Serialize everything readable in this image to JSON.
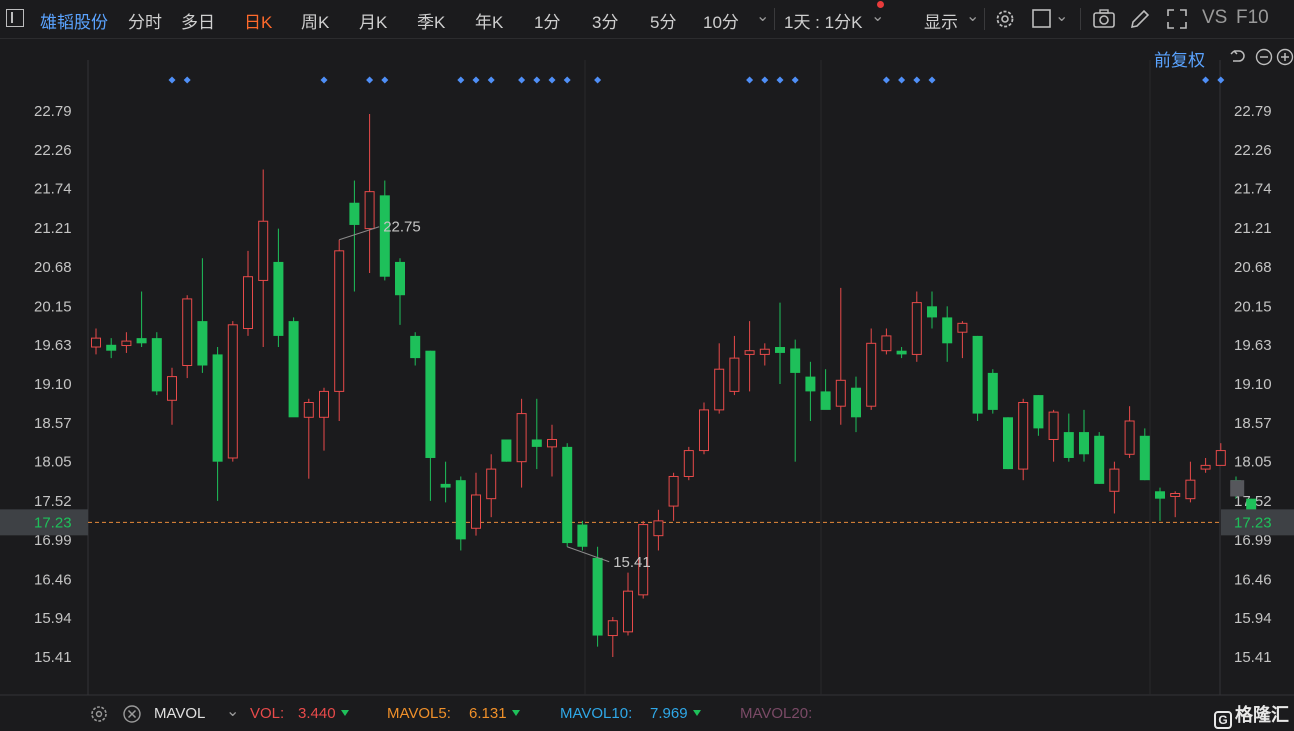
{
  "toolbar": {
    "stock_name": "雄韬股份",
    "periods": [
      "分时",
      "多日",
      "日K",
      "周K",
      "月K",
      "季K",
      "年K",
      "1分",
      "3分",
      "5分",
      "10分"
    ],
    "active_period": "日K",
    "range_label": "1天 : 1分K",
    "display_label": "显示",
    "vs_label": "VS",
    "f10_label": "F10"
  },
  "adjust_label": "前复权",
  "colors": {
    "up": "#e84a4a",
    "down": "#1ec05a",
    "marker": "#4f8ff7",
    "price_line": "#e88b3a"
  },
  "chart_data": {
    "type": "candlestick",
    "ylim": [
      15.1,
      23.1
    ],
    "yticks": [
      "22.79",
      "22.26",
      "21.74",
      "21.21",
      "20.68",
      "20.15",
      "19.63",
      "19.10",
      "18.57",
      "18.05",
      "17.52",
      "16.99",
      "16.46",
      "15.94",
      "15.41"
    ],
    "current_price": "17.23",
    "high_label": "22.75",
    "low_label": "15.41",
    "high_index": 16,
    "low_index": 31,
    "marker_indices": [
      5,
      6,
      15,
      18,
      19,
      24,
      25,
      26,
      28,
      29,
      30,
      31,
      33,
      43,
      44,
      45,
      46,
      52,
      53,
      54,
      55,
      73,
      74
    ],
    "candles": [
      {
        "o": 19.6,
        "h": 19.85,
        "l": 19.5,
        "c": 19.72
      },
      {
        "o": 19.63,
        "h": 19.72,
        "l": 19.45,
        "c": 19.55
      },
      {
        "o": 19.62,
        "h": 19.8,
        "l": 19.52,
        "c": 19.68
      },
      {
        "o": 19.72,
        "h": 20.35,
        "l": 19.6,
        "c": 19.65
      },
      {
        "o": 19.72,
        "h": 19.8,
        "l": 18.95,
        "c": 19.0
      },
      {
        "o": 18.88,
        "h": 19.32,
        "l": 18.55,
        "c": 19.2
      },
      {
        "o": 19.35,
        "h": 20.3,
        "l": 19.18,
        "c": 20.25
      },
      {
        "o": 19.95,
        "h": 20.8,
        "l": 19.25,
        "c": 19.35
      },
      {
        "o": 19.5,
        "h": 19.6,
        "l": 17.52,
        "c": 18.05
      },
      {
        "o": 18.1,
        "h": 19.95,
        "l": 18.05,
        "c": 19.9
      },
      {
        "o": 19.85,
        "h": 20.9,
        "l": 19.75,
        "c": 20.55
      },
      {
        "o": 20.5,
        "h": 22.0,
        "l": 19.6,
        "c": 21.3
      },
      {
        "o": 20.75,
        "h": 21.2,
        "l": 19.6,
        "c": 19.75
      },
      {
        "o": 19.95,
        "h": 20.0,
        "l": 18.7,
        "c": 18.65
      },
      {
        "o": 18.65,
        "h": 18.9,
        "l": 17.82,
        "c": 18.85
      },
      {
        "o": 18.65,
        "h": 19.05,
        "l": 18.2,
        "c": 19.0
      },
      {
        "o": 19.0,
        "h": 21.05,
        "l": 18.6,
        "c": 20.9
      },
      {
        "o": 21.55,
        "h": 21.85,
        "l": 20.35,
        "c": 21.25
      },
      {
        "o": 21.2,
        "h": 22.75,
        "l": 20.6,
        "c": 21.7
      },
      {
        "o": 21.65,
        "h": 21.85,
        "l": 20.5,
        "c": 20.55
      },
      {
        "o": 20.75,
        "h": 20.8,
        "l": 19.9,
        "c": 20.3
      },
      {
        "o": 19.75,
        "h": 19.8,
        "l": 19.35,
        "c": 19.45
      },
      {
        "o": 19.55,
        "h": 19.55,
        "l": 17.52,
        "c": 18.1
      },
      {
        "o": 17.75,
        "h": 18.05,
        "l": 17.5,
        "c": 17.7
      },
      {
        "o": 17.8,
        "h": 17.85,
        "l": 16.85,
        "c": 17.0
      },
      {
        "o": 17.15,
        "h": 17.9,
        "l": 17.05,
        "c": 17.6
      },
      {
        "o": 17.55,
        "h": 18.15,
        "l": 17.3,
        "c": 17.95
      },
      {
        "o": 18.35,
        "h": 18.3,
        "l": 18.05,
        "c": 18.05
      },
      {
        "o": 18.05,
        "h": 18.9,
        "l": 17.7,
        "c": 18.7
      },
      {
        "o": 18.35,
        "h": 18.9,
        "l": 17.95,
        "c": 18.25
      },
      {
        "o": 18.25,
        "h": 18.55,
        "l": 17.85,
        "c": 18.35
      },
      {
        "o": 18.25,
        "h": 18.3,
        "l": 16.9,
        "c": 16.95
      },
      {
        "o": 17.2,
        "h": 17.25,
        "l": 16.85,
        "c": 16.9
      },
      {
        "o": 16.75,
        "h": 16.9,
        "l": 15.55,
        "c": 15.7
      },
      {
        "o": 15.7,
        "h": 15.95,
        "l": 15.41,
        "c": 15.9
      },
      {
        "o": 15.75,
        "h": 16.55,
        "l": 15.7,
        "c": 16.3
      },
      {
        "o": 16.25,
        "h": 17.25,
        "l": 16.2,
        "c": 17.2
      },
      {
        "o": 17.05,
        "h": 17.4,
        "l": 16.85,
        "c": 17.25
      },
      {
        "o": 17.45,
        "h": 17.9,
        "l": 17.25,
        "c": 17.85
      },
      {
        "o": 17.85,
        "h": 18.25,
        "l": 17.8,
        "c": 18.2
      },
      {
        "o": 18.2,
        "h": 18.85,
        "l": 18.15,
        "c": 18.75
      },
      {
        "o": 18.75,
        "h": 19.65,
        "l": 18.7,
        "c": 19.3
      },
      {
        "o": 19.0,
        "h": 19.75,
        "l": 18.95,
        "c": 19.45
      },
      {
        "o": 19.5,
        "h": 19.95,
        "l": 19.0,
        "c": 19.55
      },
      {
        "o": 19.5,
        "h": 19.65,
        "l": 19.35,
        "c": 19.57
      },
      {
        "o": 19.6,
        "h": 20.2,
        "l": 19.1,
        "c": 19.52
      },
      {
        "o": 19.58,
        "h": 19.7,
        "l": 18.05,
        "c": 19.25
      },
      {
        "o": 19.2,
        "h": 19.4,
        "l": 18.6,
        "c": 19.0
      },
      {
        "o": 19.0,
        "h": 19.3,
        "l": 18.8,
        "c": 18.75
      },
      {
        "o": 18.8,
        "h": 20.4,
        "l": 18.55,
        "c": 19.15
      },
      {
        "o": 19.05,
        "h": 19.2,
        "l": 18.45,
        "c": 18.65
      },
      {
        "o": 18.8,
        "h": 19.85,
        "l": 18.75,
        "c": 19.65
      },
      {
        "o": 19.55,
        "h": 19.85,
        "l": 19.5,
        "c": 19.75
      },
      {
        "o": 19.55,
        "h": 19.6,
        "l": 19.45,
        "c": 19.5
      },
      {
        "o": 19.5,
        "h": 20.35,
        "l": 19.4,
        "c": 20.2
      },
      {
        "o": 20.15,
        "h": 20.35,
        "l": 19.85,
        "c": 20.0
      },
      {
        "o": 20.0,
        "h": 20.15,
        "l": 19.4,
        "c": 19.65
      },
      {
        "o": 19.8,
        "h": 19.95,
        "l": 19.45,
        "c": 19.92
      },
      {
        "o": 19.75,
        "h": 19.75,
        "l": 18.6,
        "c": 18.7
      },
      {
        "o": 19.25,
        "h": 19.3,
        "l": 18.7,
        "c": 18.75
      },
      {
        "o": 18.65,
        "h": 18.65,
        "l": 17.95,
        "c": 17.95
      },
      {
        "o": 17.95,
        "h": 18.9,
        "l": 17.8,
        "c": 18.85
      },
      {
        "o": 18.95,
        "h": 18.95,
        "l": 18.4,
        "c": 18.5
      },
      {
        "o": 18.35,
        "h": 18.75,
        "l": 18.05,
        "c": 18.72
      },
      {
        "o": 18.45,
        "h": 18.7,
        "l": 18.05,
        "c": 18.1
      },
      {
        "o": 18.45,
        "h": 18.75,
        "l": 18.05,
        "c": 18.15
      },
      {
        "o": 18.4,
        "h": 18.45,
        "l": 17.75,
        "c": 17.75
      },
      {
        "o": 17.65,
        "h": 18.05,
        "l": 17.35,
        "c": 17.95
      },
      {
        "o": 18.15,
        "h": 18.8,
        "l": 18.1,
        "c": 18.6
      },
      {
        "o": 18.4,
        "h": 18.5,
        "l": 17.8,
        "c": 17.8
      },
      {
        "o": 17.65,
        "h": 17.7,
        "l": 17.25,
        "c": 17.55
      },
      {
        "o": 17.58,
        "h": 17.65,
        "l": 17.3,
        "c": 17.62
      },
      {
        "o": 17.55,
        "h": 18.05,
        "l": 17.5,
        "c": 17.8
      },
      {
        "o": 17.95,
        "h": 18.1,
        "l": 17.9,
        "c": 18.0
      },
      {
        "o": 18.0,
        "h": 18.3,
        "l": 18.0,
        "c": 18.2
      },
      {
        "o": 17.8,
        "h": 17.85,
        "l": 17.55,
        "c": 17.6
      },
      {
        "o": 17.55,
        "h": 17.55,
        "l": 17.08,
        "c": 17.23
      }
    ]
  },
  "indicator": {
    "name": "MAVOL",
    "vol_label": "VOL:",
    "vol_value": "3.440",
    "mavol5_label": "MAVOL5:",
    "mavol5_value": "6.131",
    "mavol10_label": "MAVOL10:",
    "mavol10_value": "7.969",
    "mavol20_label": "MAVOL20:"
  },
  "logo_text": "格隆汇"
}
